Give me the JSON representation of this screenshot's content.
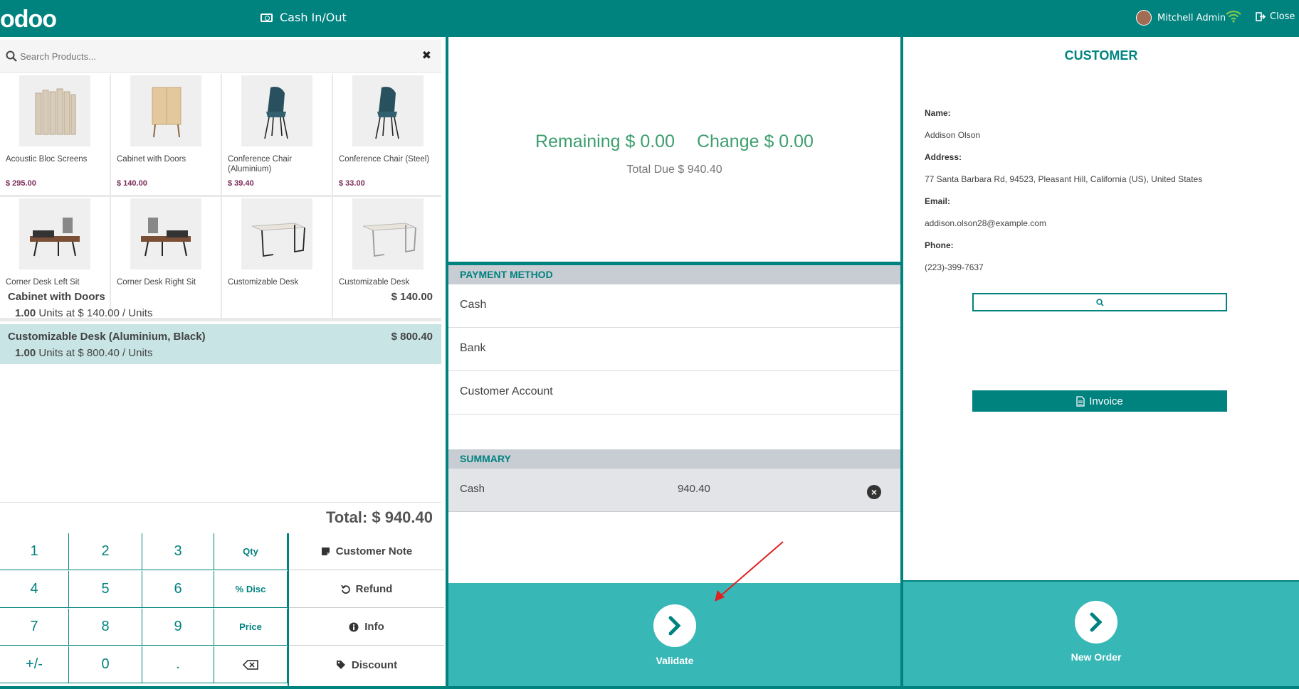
{
  "header": {
    "logo": "odoo",
    "cash_in_out": "Cash In/Out",
    "user_name": "Mitchell Admin",
    "close": "Close"
  },
  "search": {
    "placeholder": "Search Products..."
  },
  "products": [
    {
      "name": "Acoustic Bloc Screens",
      "price": "$ 295.00"
    },
    {
      "name": "Cabinet with Doors",
      "price": "$ 140.00"
    },
    {
      "name": "Conference Chair (Aluminium)",
      "price": "$ 39.40"
    },
    {
      "name": "Conference Chair (Steel)",
      "price": "$ 33.00"
    },
    {
      "name": "Corner Desk Left Sit",
      "price": ""
    },
    {
      "name": "Corner Desk Right Sit",
      "price": ""
    },
    {
      "name": "Customizable Desk",
      "price": ""
    },
    {
      "name": "Customizable Desk",
      "price": ""
    }
  ],
  "orderlines": [
    {
      "name": "Cabinet with Doors",
      "price": "$ 140.00",
      "qty": "1.00",
      "unit_info": "Units at $ 140.00 / Units"
    },
    {
      "name": "Customizable Desk (Aluminium, Black)",
      "price": "$ 800.40",
      "qty": "1.00",
      "unit_info": "Units at $ 800.40 / Units"
    }
  ],
  "total": "Total: $ 940.40",
  "numpad": {
    "keys": [
      "1",
      "2",
      "3",
      "Qty",
      "4",
      "5",
      "6",
      "% Disc",
      "7",
      "8",
      "9",
      "Price",
      "+/-",
      "0",
      "."
    ]
  },
  "actions": {
    "customer_note": "Customer Note",
    "refund": "Refund",
    "info": "Info",
    "discount": "Discount"
  },
  "payment": {
    "remaining": "Remaining $ 0.00",
    "change": "Change $ 0.00",
    "total_due": "Total Due  $ 940.40",
    "method_title": "PAYMENT METHOD",
    "methods": [
      "Cash",
      "Bank",
      "Customer Account"
    ],
    "summary_title": "SUMMARY",
    "summary_method": "Cash",
    "summary_amount": "940.40",
    "validate": "Validate"
  },
  "customer": {
    "title": "CUSTOMER",
    "name_label": "Name:",
    "name": "Addison Olson",
    "address_label": "Address:",
    "address": "77 Santa Barbara Rd, 94523, Pleasant Hill, California (US), United States",
    "email_label": "Email:",
    "email": "addison.olson28@example.com",
    "phone_label": "Phone:",
    "phone": "(223)-399-7637",
    "invoice": "Invoice",
    "new_order": "New Order"
  },
  "colors": {
    "primary": "#00827f",
    "accent": "#38b7b7",
    "positive": "#3d9e6e",
    "price": "#7b2c5b"
  }
}
